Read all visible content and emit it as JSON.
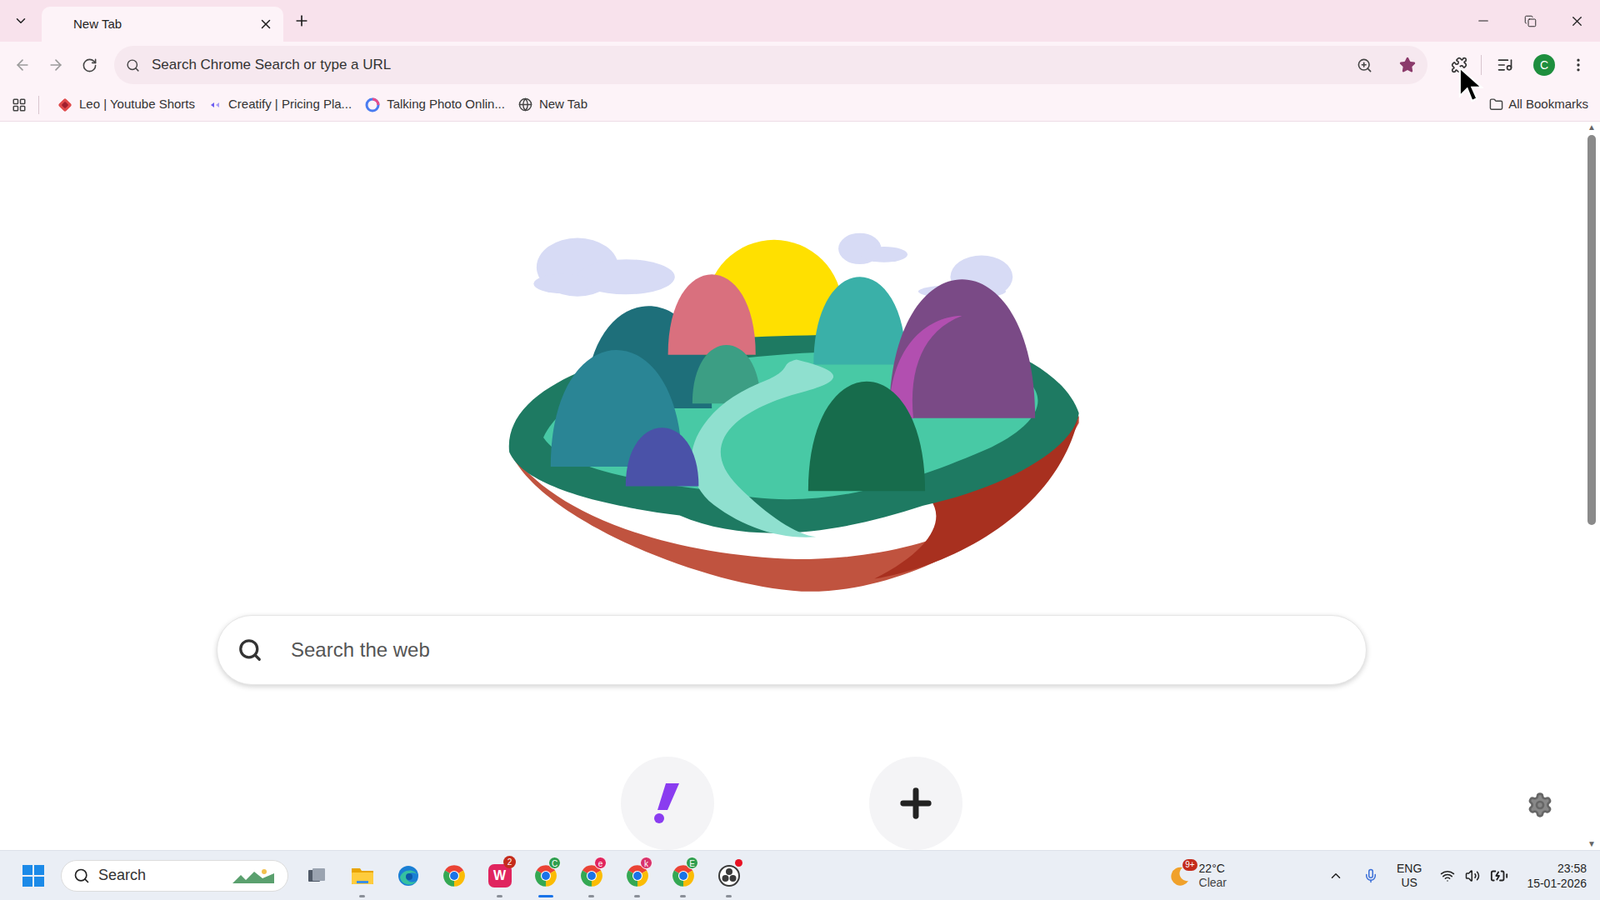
{
  "window": {
    "tabs": [
      {
        "label": "New Tab",
        "selected": true
      }
    ]
  },
  "toolbar": {
    "omnibox_placeholder": "Search Chrome Search or type a URL",
    "bookmarked": true,
    "profile_initial": "C"
  },
  "bookmarks": {
    "items": [
      {
        "label": "Leo | Youtube Shorts",
        "kind": "leo"
      },
      {
        "label": "Creatify | Pricing Pla...",
        "kind": "creatify"
      },
      {
        "label": "Talking Photo Onlin...",
        "kind": "google"
      },
      {
        "label": "New Tab",
        "kind": "globe"
      }
    ],
    "all": "All Bookmarks"
  },
  "page": {
    "search_placeholder": "Search the web"
  },
  "taskbar": {
    "search": "Search",
    "apps": [
      {
        "kind": "taskview",
        "icon_text": "",
        "badge": "",
        "color": "",
        "running": false,
        "active": false,
        "alert": false
      },
      {
        "kind": "files",
        "icon_text": "",
        "badge": "",
        "color": "",
        "running": true,
        "active": false,
        "alert": false
      },
      {
        "kind": "edge",
        "icon_text": "",
        "badge": "",
        "color": "",
        "running": false,
        "active": false,
        "alert": false
      },
      {
        "kind": "chrome",
        "icon_text": "",
        "badge": "",
        "color": "",
        "running": false,
        "active": false,
        "alert": false
      },
      {
        "kind": "word",
        "icon_text": "W",
        "badge": "2",
        "color": "#e0245e",
        "running": true,
        "active": false,
        "alert": false
      },
      {
        "kind": "chrome",
        "icon_text": "",
        "badge": "C",
        "color": "#2e9e4f",
        "running": true,
        "active": true,
        "alert": false
      },
      {
        "kind": "chrome",
        "icon_text": "",
        "badge": "e",
        "color": "#e0245e",
        "running": true,
        "active": false,
        "alert": false
      },
      {
        "kind": "chrome",
        "icon_text": "",
        "badge": "k",
        "color": "#d8326b",
        "running": true,
        "active": false,
        "alert": false
      },
      {
        "kind": "chrome",
        "icon_text": "",
        "badge": "E",
        "color": "#2e9e4f",
        "running": true,
        "active": false,
        "alert": false
      },
      {
        "kind": "obs",
        "icon_text": "",
        "badge": "",
        "color": "",
        "running": true,
        "active": false,
        "alert": true
      }
    ],
    "weather": {
      "badge": "9+",
      "temp": "22°C",
      "condition": "Clear"
    },
    "lang": "ENG",
    "region": "US",
    "time": "23:58",
    "date": "15-01-2026"
  }
}
